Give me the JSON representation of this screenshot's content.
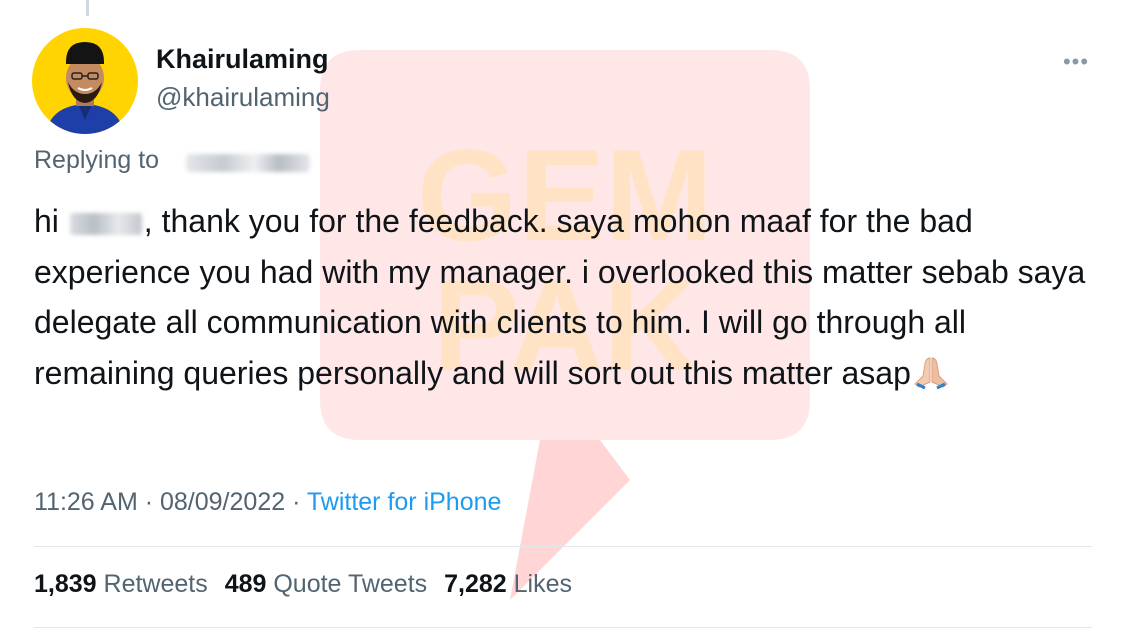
{
  "tweet": {
    "author": {
      "display_name": "Khairulaming",
      "handle": "@khairulaming"
    },
    "replying_to_label": "Replying to",
    "body": {
      "greeting": "hi",
      "part1": ", thank you for the feedback. saya mohon maaf for the bad experience you had with my manager. i overlooked this matter sebab saya delegate all communication with clients to him. I will go through all remaining queries personally and will sort out this matter asap",
      "emoji": "folded-hands-emoji"
    },
    "meta": {
      "time": "11:26 AM",
      "separator": " · ",
      "date": "08/09/2022",
      "source": "Twitter for iPhone"
    },
    "stats": {
      "retweets_count": "1,839",
      "retweets_label": "Retweets",
      "quote_tweets_count": "489",
      "quote_tweets_label": "Quote Tweets",
      "likes_count": "7,282",
      "likes_label": "Likes"
    },
    "more_icon": "more-dots-icon"
  },
  "watermark": {
    "icon": "gempak-logo-watermark",
    "color": "#ff4d4d"
  },
  "colors": {
    "link": "#1d9bf0",
    "secondary_text": "#536471",
    "primary_text": "#0f1419",
    "avatar_bg": "#ffd500"
  }
}
